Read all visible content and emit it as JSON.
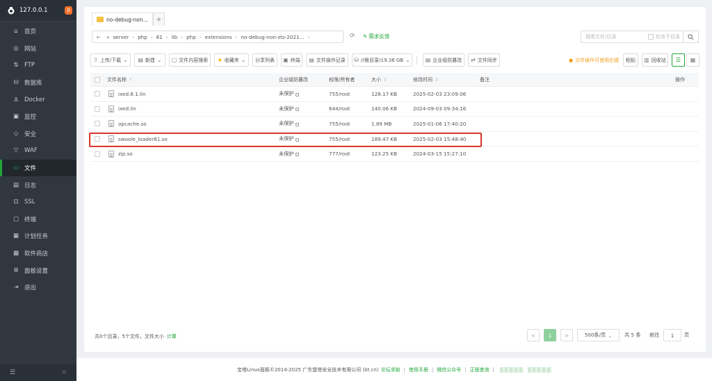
{
  "sidebar": {
    "ip": "127.0.0.1",
    "badge": "0",
    "items": [
      {
        "label": "首页",
        "icon": "home-icon"
      },
      {
        "label": "网站",
        "icon": "globe-icon"
      },
      {
        "label": "FTP",
        "icon": "ftp-icon"
      },
      {
        "label": "数据库",
        "icon": "database-icon"
      },
      {
        "label": "Docker",
        "icon": "docker-icon"
      },
      {
        "label": "监控",
        "icon": "monitor-icon"
      },
      {
        "label": "安全",
        "icon": "shield-icon"
      },
      {
        "label": "WAF",
        "icon": "waf-icon"
      },
      {
        "label": "文件",
        "icon": "folder-icon",
        "active": true
      },
      {
        "label": "日志",
        "icon": "log-icon"
      },
      {
        "label": "SSL",
        "icon": "ssl-icon"
      },
      {
        "label": "终端",
        "icon": "terminal-icon"
      },
      {
        "label": "计划任务",
        "icon": "calendar-icon"
      },
      {
        "label": "软件商店",
        "icon": "store-icon"
      },
      {
        "label": "面板设置",
        "icon": "settings-icon"
      },
      {
        "label": "退出",
        "icon": "logout-icon"
      }
    ]
  },
  "tabs": {
    "active": "no-debug-non...",
    "add": "+"
  },
  "address": {
    "back": "←",
    "prefix": "«",
    "crumbs": [
      "server",
      "php",
      "81",
      "lib",
      "php",
      "extensions",
      "no-debug-non-zts-2021..."
    ],
    "feedback": "需求反馈",
    "search_placeholder": "搜索文件/目录",
    "include_sub": "包含子目录"
  },
  "toolbar": {
    "upload": "上传/下载",
    "new": "新建",
    "content_search": "文件内容搜索",
    "favorites": "收藏夹",
    "share_list": "分享列表",
    "terminal": "终端",
    "op_log": "文件操作记录",
    "disk": "/(根目录)19.38 GB",
    "protect": "企业级防篡改",
    "sync": "文件同步",
    "warn": "文件操作可使用右键",
    "paste": "粘贴",
    "recycle": "回收站"
  },
  "table": {
    "headers": {
      "name": "文件名称",
      "protect": "企业级防篡改",
      "perm": "权限/所有者",
      "size": "大小",
      "time": "修改时间",
      "note": "备注",
      "ops": "操作"
    },
    "rows": [
      {
        "name": "ixed.8.1.lin",
        "protect": "未保护",
        "perm": "755/root",
        "size": "128.17 KB",
        "time": "2025-02-03 23:09:06"
      },
      {
        "name": "ixed.lin",
        "protect": "未保护",
        "perm": "644/root",
        "size": "140.06 KB",
        "time": "2024-09-03 09:34:16"
      },
      {
        "name": "opcache.so",
        "protect": "未保护",
        "perm": "755/root",
        "size": "1.89 MB",
        "time": "2025-01-06 17:40:20"
      },
      {
        "name": "swoole_loader81.so",
        "protect": "未保护",
        "perm": "755/root",
        "size": "189.47 KB",
        "time": "2025-02-03 15:48:40"
      },
      {
        "name": "zip.so",
        "protect": "未保护",
        "perm": "777/root",
        "size": "123.25 KB",
        "time": "2024-03-15 15:27:10"
      }
    ]
  },
  "footer": {
    "summary": "共0个目录，5个文件，文件大小",
    "calc": "计算",
    "prev": "<",
    "page": "1",
    "next": ">",
    "per_page": "500条/页",
    "total": "共 5 条",
    "goto": "前往",
    "goto_value": "1",
    "page_unit": "页"
  },
  "copyright": {
    "text": "宝塔Linux面板©2014-2025 广东堡塔安全技术有限公司 (bt.cn)",
    "links": [
      "论坛求助",
      "使用手册",
      "微信公众号",
      "正版查询"
    ]
  }
}
